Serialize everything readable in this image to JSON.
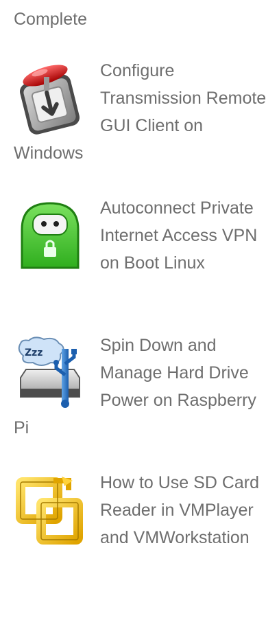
{
  "top_text": "Complete",
  "posts": [
    {
      "title": "Configure Transmission Remote GUI Client on Windows",
      "icon": "transmission-icon"
    },
    {
      "title": "Autoconnect Private Internet Access VPN on Boot Linux",
      "icon": "vpn-robot-icon"
    },
    {
      "title": "Spin Down and Manage Hard Drive Power on Raspberry Pi",
      "icon": "hard-drive-sleep-icon"
    },
    {
      "title": "How to Use SD Card Reader in VMPlayer and VMWorkstation",
      "icon": "vmware-icon"
    }
  ]
}
